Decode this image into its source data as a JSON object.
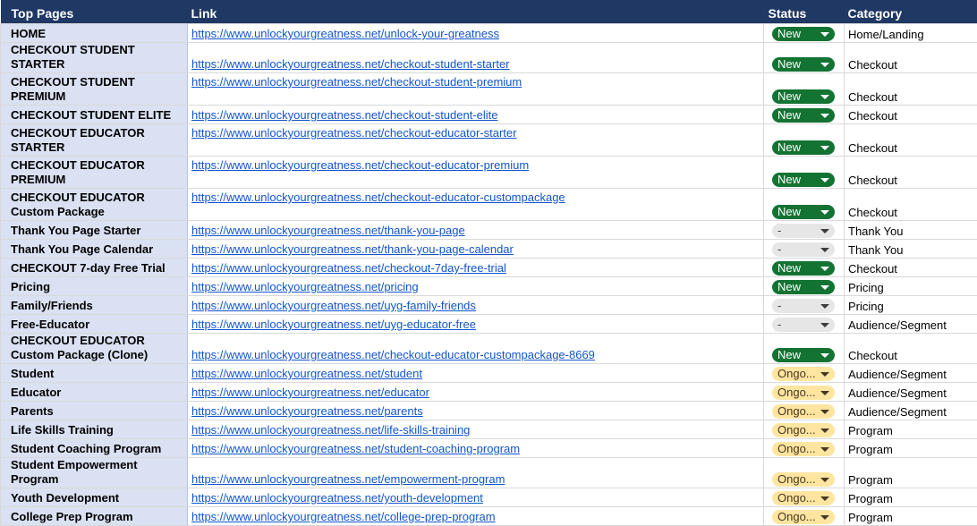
{
  "headers": {
    "page": "Top Pages",
    "link": "Link",
    "status": "Status",
    "category": "Category"
  },
  "colors": {
    "header_bg": "#1f3864",
    "page_col_bg": "#d9e1f2",
    "new_chip": "#137333",
    "ongoing_chip": "#ffe5a0",
    "none_chip": "#e6e6e6",
    "link": "#1155cc"
  },
  "rows": [
    {
      "page": "HOME",
      "link": "https://www.unlockyourgreatness.net/unlock-your-greatness",
      "status": "New",
      "category": "Home/Landing"
    },
    {
      "page": "CHECKOUT STUDENT STARTER",
      "link": "https://www.unlockyourgreatness.net/checkout-student-starter",
      "status": "New",
      "category": "Checkout"
    },
    {
      "page": "CHECKOUT STUDENT PREMIUM",
      "link": "https://www.unlockyourgreatness.net/checkout-student-premium",
      "status": "New",
      "category": "Checkout"
    },
    {
      "page": "CHECKOUT STUDENT ELITE",
      "link": "https://www.unlockyourgreatness.net/checkout-student-elite",
      "status": "New",
      "category": "Checkout"
    },
    {
      "page": "CHECKOUT EDUCATOR STARTER",
      "link": "https://www.unlockyourgreatness.net/checkout-educator-starter",
      "status": "New",
      "category": "Checkout"
    },
    {
      "page": "CHECKOUT EDUCATOR PREMIUM",
      "link": "https://www.unlockyourgreatness.net/checkout-educator-premium",
      "status": "New",
      "category": "Checkout"
    },
    {
      "page": "CHECKOUT EDUCATOR Custom Package",
      "link": "https://www.unlockyourgreatness.net/checkout-educator-custompackage",
      "status": "New",
      "category": "Checkout"
    },
    {
      "page": "Thank You Page Starter",
      "link": "https://www.unlockyourgreatness.net/thank-you-page",
      "status": "-",
      "category": "Thank You"
    },
    {
      "page": "Thank You Page Calendar",
      "link": "https://www.unlockyourgreatness.net/thank-you-page-calendar",
      "status": "-",
      "category": "Thank You"
    },
    {
      "page": "CHECKOUT 7-day Free Trial",
      "link": "https://www.unlockyourgreatness.net/checkout-7day-free-trial",
      "status": "New",
      "category": "Checkout"
    },
    {
      "page": "Pricing",
      "link": "https://www.unlockyourgreatness.net/pricing",
      "status": "New",
      "category": "Pricing"
    },
    {
      "page": "Family/Friends",
      "link": "https://www.unlockyourgreatness.net/uyg-family-friends",
      "status": "-",
      "category": "Pricing"
    },
    {
      "page": "Free-Educator",
      "link": "https://www.unlockyourgreatness.net/uyg-educator-free",
      "status": "-",
      "category": "Audience/Segment"
    },
    {
      "page": "CHECKOUT EDUCATOR Custom Package (Clone)",
      "link": "https://www.unlockyourgreatness.net/checkout-educator-custompackage-8669",
      "status": "New",
      "category": "Checkout"
    },
    {
      "page": "Student",
      "link": "https://www.unlockyourgreatness.net/student",
      "status": "Ongo...",
      "category": "Audience/Segment"
    },
    {
      "page": "Educator",
      "link": "https://www.unlockyourgreatness.net/educator",
      "status": "Ongo...",
      "category": "Audience/Segment"
    },
    {
      "page": "Parents",
      "link": "https://www.unlockyourgreatness.net/parents",
      "status": "Ongo...",
      "category": "Audience/Segment"
    },
    {
      "page": "Life Skills Training",
      "link": "https://www.unlockyourgreatness.net/life-skills-training",
      "status": "Ongo...",
      "category": "Program"
    },
    {
      "page": "Student Coaching Program",
      "link": "https://www.unlockyourgreatness.net/student-coaching-program",
      "status": "Ongo...",
      "category": "Program"
    },
    {
      "page": "Student Empowerment Program",
      "link": "https://www.unlockyourgreatness.net/empowerment-program",
      "status": "Ongo...",
      "category": "Program"
    },
    {
      "page": "Youth Development",
      "link": "https://www.unlockyourgreatness.net/youth-development",
      "status": "Ongo...",
      "category": "Program"
    },
    {
      "page": "College Prep Program",
      "link": "https://www.unlockyourgreatness.net/college-prep-program",
      "status": "Ongo...",
      "category": "Program"
    }
  ]
}
